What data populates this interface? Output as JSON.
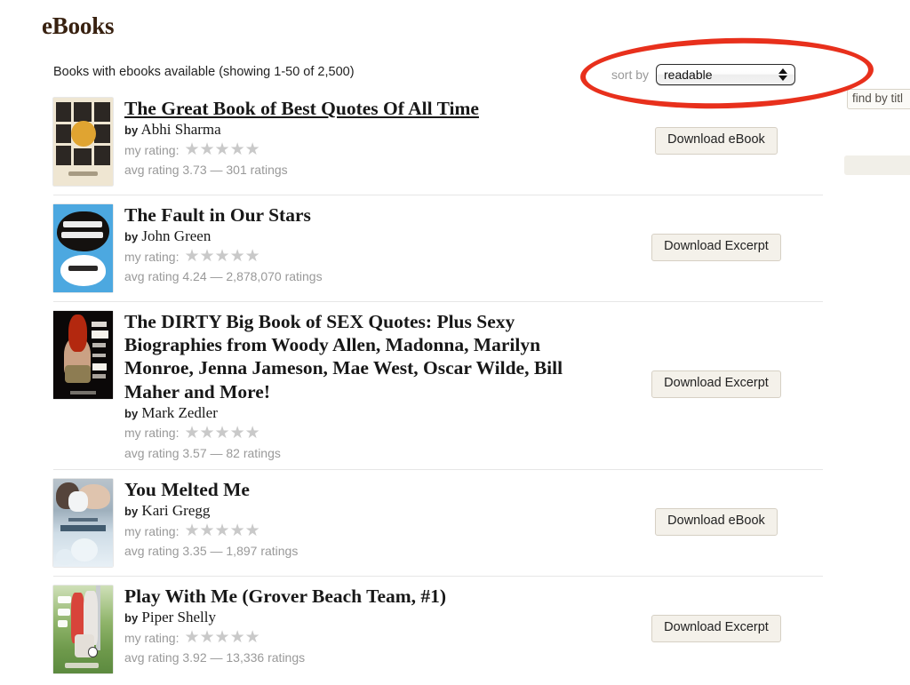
{
  "page": {
    "title": "eBooks",
    "subheading": "Books with ebooks available (showing 1-50 of 2,500)"
  },
  "controls": {
    "sort_label": "sort by",
    "sort_value": "readable",
    "sort_options": [
      "readable"
    ],
    "find_field_text": "find by titl",
    "annotation_color": "#e8301c"
  },
  "labels": {
    "by": "by",
    "my_rating": "my rating:",
    "stars": "★★★★★"
  },
  "books": [
    {
      "title": "The Great Book of Best Quotes Of All Time",
      "author": "Abhi Sharma",
      "avg_rating": "avg rating 3.73 — 301 ratings",
      "action": "Download eBook",
      "cover_name": "cover-great-book-of-best-quotes",
      "hovered": true
    },
    {
      "title": "The Fault in Our Stars",
      "author": "John Green",
      "avg_rating": "avg rating 4.24 — 2,878,070 ratings",
      "action": "Download Excerpt",
      "cover_name": "cover-the-fault-in-our-stars",
      "hovered": false
    },
    {
      "title": "The DIRTY Big Book of SEX Quotes: Plus Sexy Biographies from Woody Allen, Madonna, Marilyn Monroe, Jenna Jameson, Mae West, Oscar Wilde, Bill Maher and More!",
      "author": "Mark Zedler",
      "avg_rating": "avg rating 3.57 — 82 ratings",
      "action": "Download Excerpt",
      "cover_name": "cover-dirty-big-book-of-sex-quotes",
      "hovered": false
    },
    {
      "title": "You Melted Me",
      "author": "Kari Gregg",
      "avg_rating": "avg rating 3.35 — 1,897 ratings",
      "action": "Download eBook",
      "cover_name": "cover-you-melted-me",
      "hovered": false
    },
    {
      "title": "Play With Me (Grover Beach Team, #1)",
      "author": "Piper Shelly",
      "avg_rating": "avg rating 3.92 — 13,336 ratings",
      "action": "Download Excerpt",
      "cover_name": "cover-play-with-me",
      "hovered": false
    }
  ]
}
